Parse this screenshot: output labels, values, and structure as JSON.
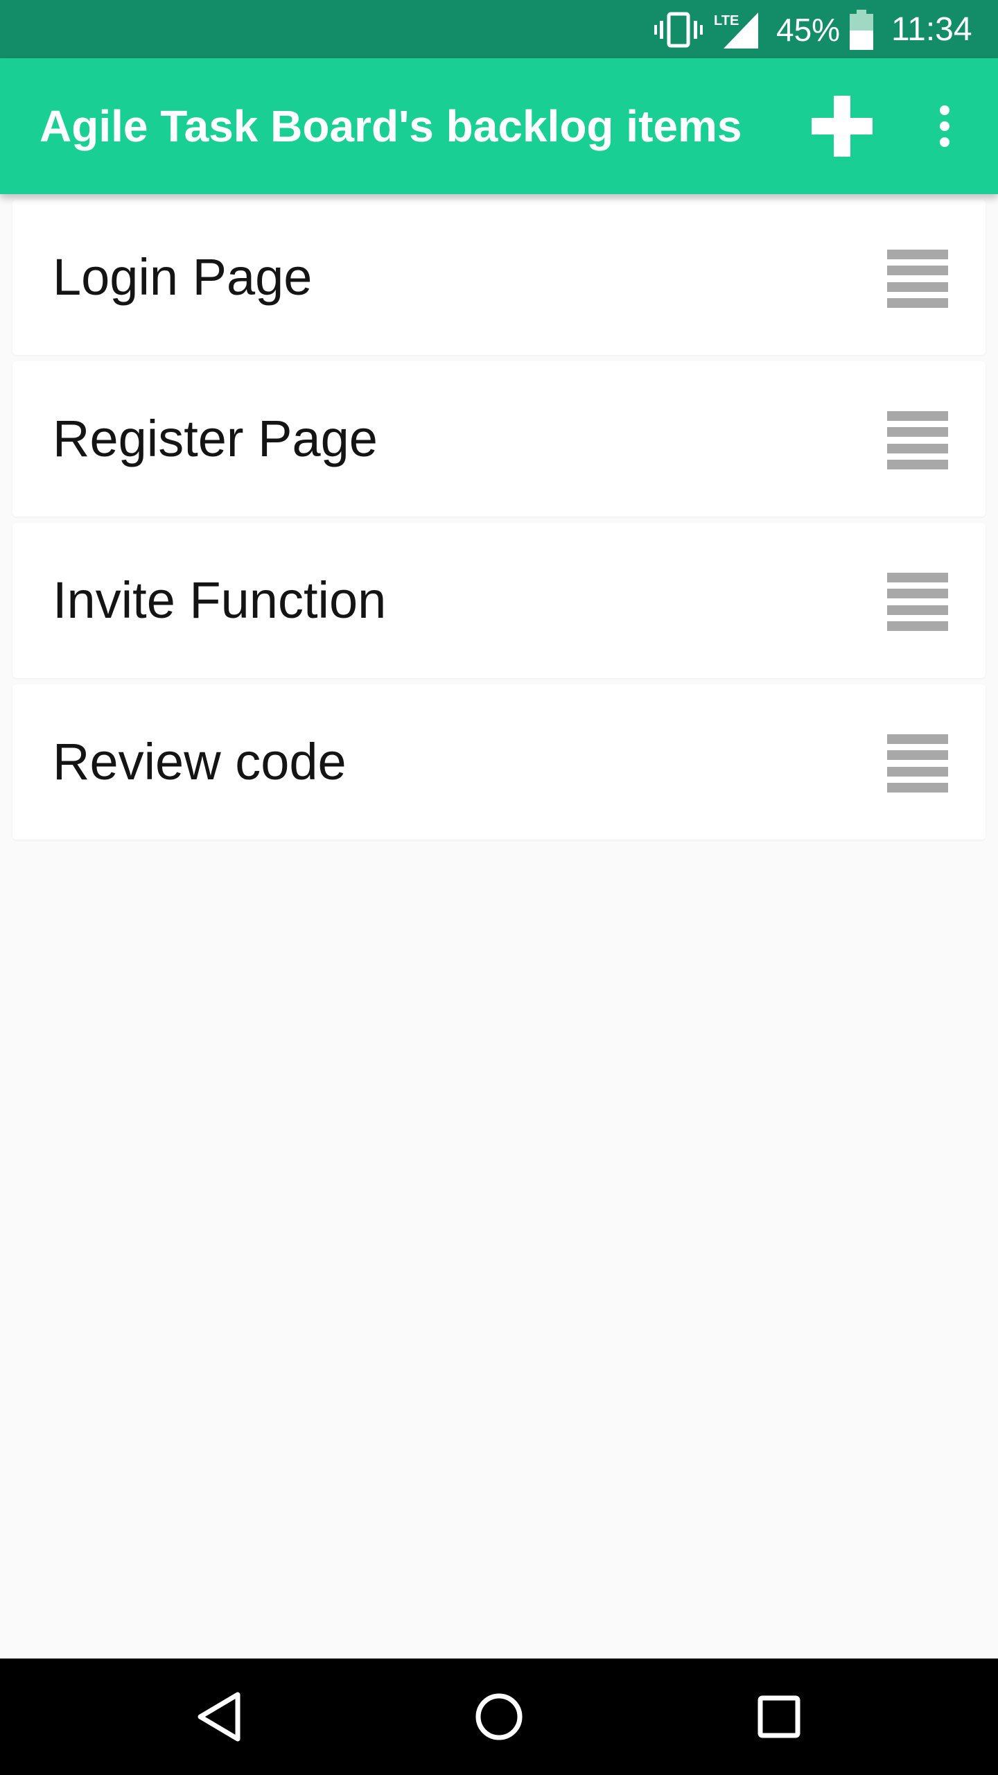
{
  "status_bar": {
    "battery_percent": "45%",
    "time": "11:34",
    "network_label": "LTE",
    "icons": [
      "vibrate-icon",
      "signal-lte-icon",
      "battery-icon"
    ]
  },
  "app_bar": {
    "title": "Agile Task Board's backlog items",
    "actions": [
      "add-icon",
      "more-vert-icon"
    ]
  },
  "backlog_items": [
    {
      "label": "Login Page"
    },
    {
      "label": "Register Page"
    },
    {
      "label": "Invite Function"
    },
    {
      "label": "Review code"
    }
  ],
  "nav_bar": {
    "buttons": [
      "back-icon",
      "home-icon",
      "recents-icon"
    ]
  },
  "colors": {
    "status_bar": "#138d68",
    "app_bar": "#1acf94",
    "background": "#fafafa",
    "card": "#ffffff",
    "text": "#141414",
    "drag_handle": "#a8a8a8",
    "nav_bar": "#000000"
  }
}
